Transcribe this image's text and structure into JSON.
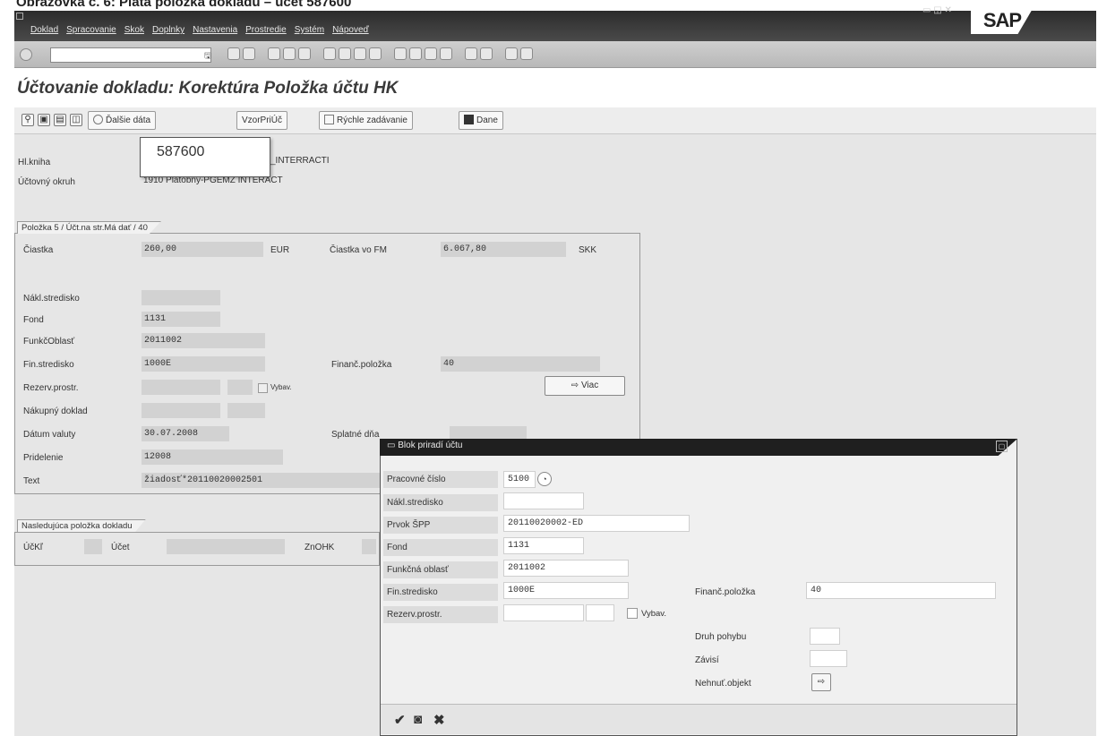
{
  "doc_caption": "Obrazovka č. 6: Piata položka dokladu – účet 587600",
  "menu": [
    "Doklad",
    "Spracovanie",
    "Skok",
    "Doplnky",
    "Nastavenia",
    "Prostredie",
    "Systém",
    "Nápoveď"
  ],
  "window_controls": "▭ ◱ ✕",
  "sap_logo": "SAP",
  "command_save_glyph": "🖫",
  "page_title": "Účtovanie dokladu: Korektúra Položka účtu HK",
  "toolbar": {
    "more_data": "Ďalšie dáta",
    "template": "VzorPriÚč",
    "fast_entry": "Rýchle zadávanie",
    "taxes": "Dane",
    "small_icons": [
      "⚲",
      "▣",
      "▤",
      "◫"
    ]
  },
  "account_popup": "587600",
  "header": {
    "hl_acct_label": "Hl.kniha",
    "hl_acct_value": "_INTERRACTI",
    "company_label": "Účtovný okruh",
    "company_value": "1910 Platobný-PGEMZ INTERACT"
  },
  "item_group": {
    "title": "Položka 5 / Účt.na str.Má dať / 40",
    "amount_label": "Čiastka",
    "amount_value": "260,00",
    "currency": "EUR",
    "fm_amount_label": "Čiastka vo FM",
    "fm_amount_value": "6.067,80",
    "fm_currency": "SKK",
    "cost_center_label": "Nákl.stredisko",
    "fund_label": "Fond",
    "fund_value": "1131",
    "func_area_label": "FunkčOblasť",
    "func_area_value": "2011002",
    "fin_center_label": "Fin.stredisko",
    "fin_center_value": "1000E",
    "commit_item_label": "Finanč.položka",
    "commit_item_value": "40",
    "earmark_label": "Rezerv.prostr.",
    "earmark_check": "Vybav.",
    "more_button": "Viac",
    "po_label": "Nákupný doklad",
    "value_date_label": "Dátum valuty",
    "value_date_value": "30.07.2008",
    "due_label": "Splatné dňa",
    "assignment_label": "Pridelenie",
    "assignment_value": "12008",
    "text_label": "Text",
    "text_value": "žiadosť*20110020002501"
  },
  "next_group": {
    "title": "Nasledujúca položka dokladu",
    "posting_key_label": "ÚčKľ",
    "account_label": "Účet",
    "special_gl_label": "ZnOHK"
  },
  "dialog": {
    "title": "Blok priradí účtu",
    "close_glyph": "▢",
    "fields": [
      {
        "label": "Pracovné číslo",
        "value": "5100"
      },
      {
        "label": "Nákl.stredisko",
        "value": ""
      },
      {
        "label": "Prvok ŠPP",
        "value": "20110020002-ED"
      },
      {
        "label": "Fond",
        "value": "1131"
      },
      {
        "label": "Funkčná oblasť",
        "value": "2011002"
      },
      {
        "label": "Fin.stredisko",
        "value": "1000E"
      },
      {
        "label": "Rezerv.prostr.",
        "value": ""
      }
    ],
    "earmark_check": "Vybav.",
    "commit_item_label": "Finanč.položka",
    "commit_item_value": "40",
    "movement_label": "Druh pohybu",
    "movement_value": "",
    "dependency_label": "Závisí",
    "dependency_value": "",
    "real_object_label": "Nehnuť.objekt",
    "footer_icons": [
      "✔",
      "◙",
      "✖"
    ]
  }
}
